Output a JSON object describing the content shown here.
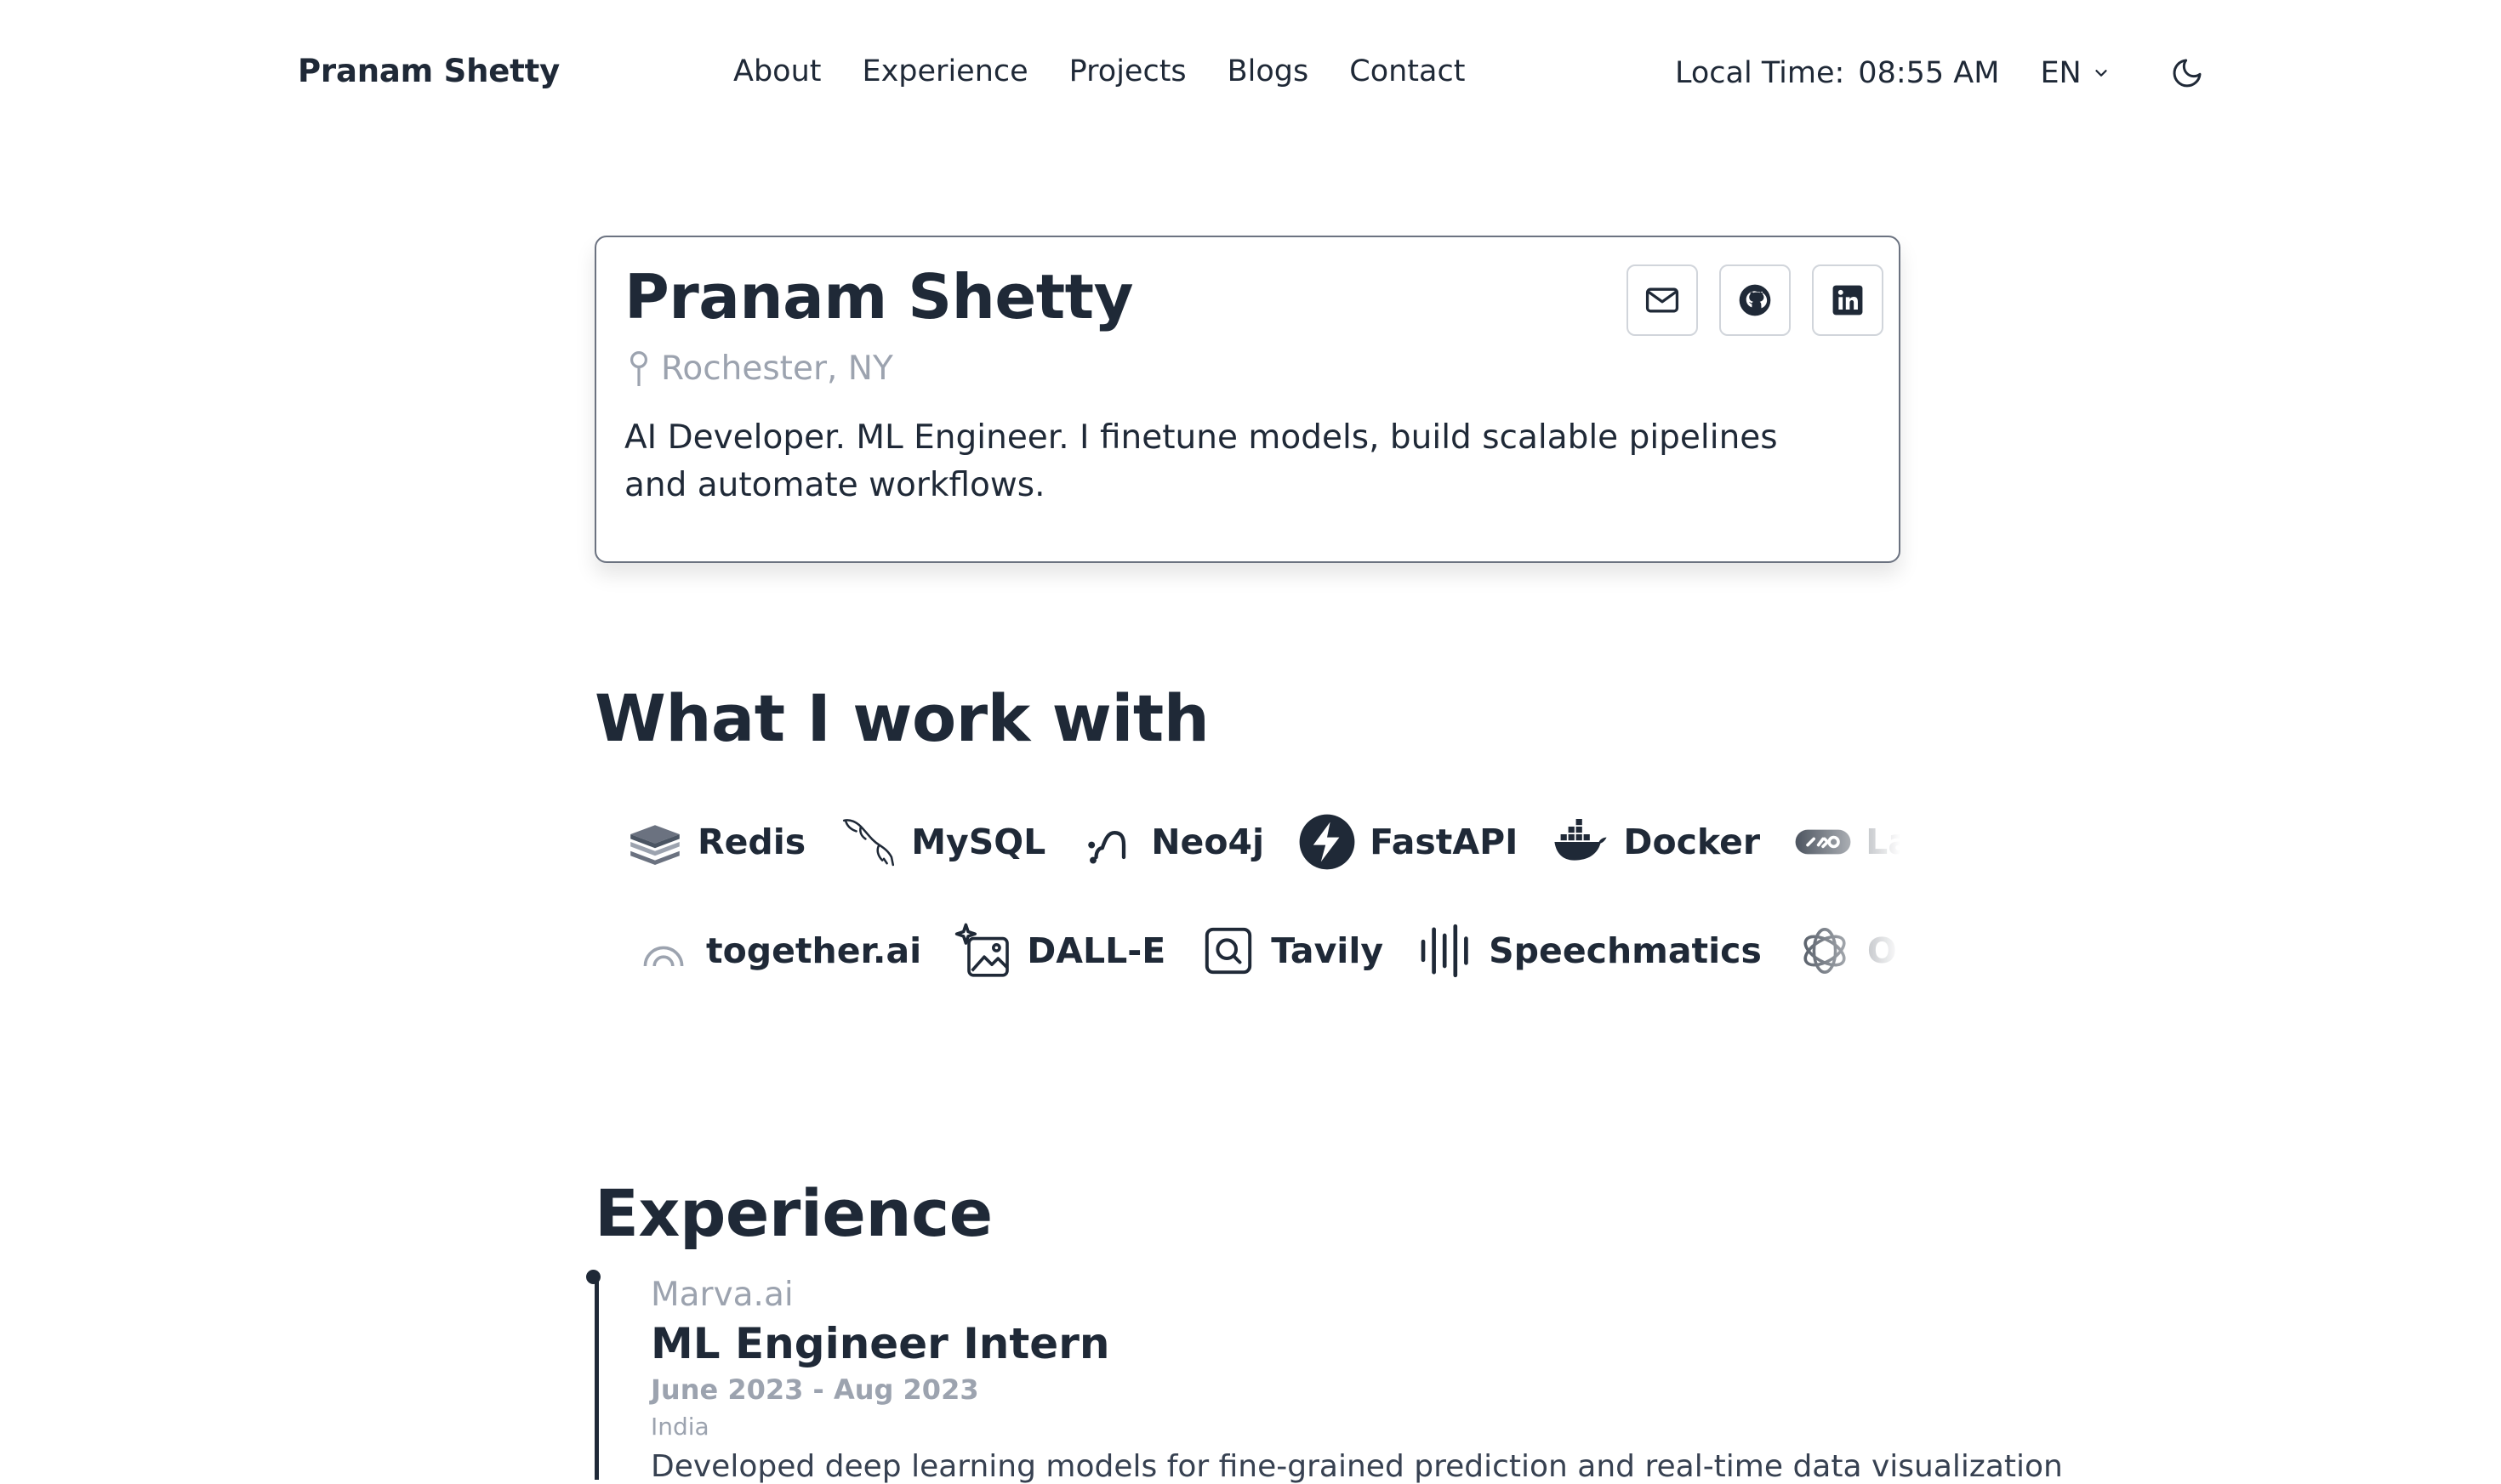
{
  "header": {
    "brand": "Pranam Shetty",
    "nav": [
      "About",
      "Experience",
      "Projects",
      "Blogs",
      "Contact"
    ],
    "local_time_label": "Local Time:",
    "local_time_value": "08:55 AM",
    "language": "EN",
    "theme_icon": "moon-icon"
  },
  "profile": {
    "name": "Pranam Shetty",
    "location": "Rochester, NY",
    "bio": "AI Developer. ML Engineer. I finetune models, build scalable pipelines and automate workflows.",
    "social_icons": [
      "mail-icon",
      "github-icon",
      "linkedin-icon"
    ]
  },
  "skills": {
    "title": "What I work with",
    "row1": [
      "Redis",
      "MySQL",
      "Neo4j",
      "FastAPI",
      "Docker",
      "LangChain"
    ],
    "row2": [
      "together.ai",
      "DALL-E",
      "Tavily",
      "Speechmatics",
      "OpenAI",
      ""
    ]
  },
  "experience": {
    "title": "Experience",
    "items": [
      {
        "company": "Marva.ai",
        "role": "ML Engineer Intern",
        "dates": "June 2023 - Aug 2023",
        "location": "India",
        "description": "Developed deep learning models for fine-grained prediction and real-time data visualization"
      }
    ]
  },
  "colors": {
    "text": "#1f2937",
    "muted": "#9ca3af",
    "card_border": "#6b7280",
    "background": "#ffffff"
  }
}
